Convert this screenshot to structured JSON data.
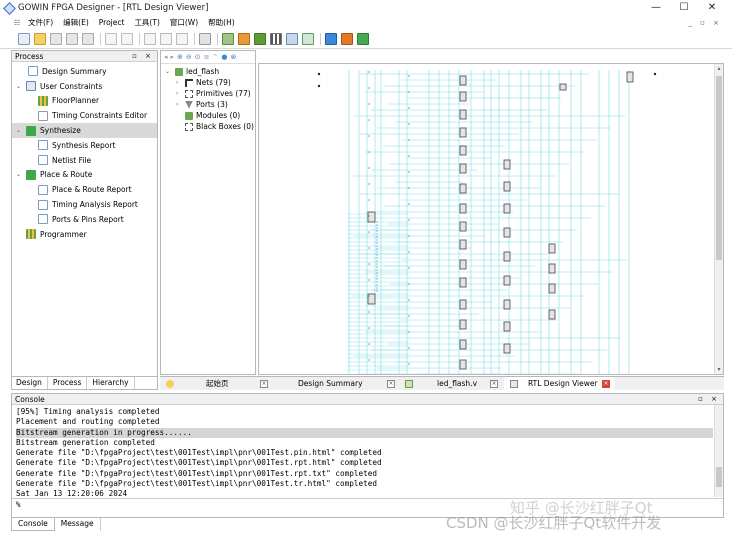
{
  "window": {
    "title": "GOWIN FPGA Designer - [RTL Design Viewer]",
    "controls": [
      "—",
      "☐",
      "✕"
    ]
  },
  "menubar": {
    "items": [
      "文件(F)",
      "编辑(E)",
      "Project",
      "工具(T)",
      "窗口(W)",
      "帮助(H)"
    ],
    "mdi_controls": "_ ▫ ×"
  },
  "process_panel": {
    "title": "Process",
    "controls": "▫ ×",
    "items": [
      {
        "label": "Design Summary",
        "level": 1,
        "icon": "document-icon"
      },
      {
        "label": "User Constraints",
        "level": 0,
        "expanded": true,
        "icon": "constraints-icon"
      },
      {
        "label": "FloorPlanner",
        "level": 1,
        "icon": "floorplanner-icon"
      },
      {
        "label": "Timing Constraints Editor",
        "level": 1,
        "icon": "clock-icon"
      },
      {
        "label": "Synthesize",
        "level": 0,
        "expanded": true,
        "icon": "check-icon",
        "selected": true
      },
      {
        "label": "Synthesis Report",
        "level": 1,
        "icon": "document-icon"
      },
      {
        "label": "Netlist File",
        "level": 1,
        "icon": "document-icon"
      },
      {
        "label": "Place & Route",
        "level": 0,
        "expanded": true,
        "icon": "check-icon"
      },
      {
        "label": "Place & Route Report",
        "level": 1,
        "icon": "document-icon"
      },
      {
        "label": "Timing Analysis Report",
        "level": 1,
        "icon": "document-icon"
      },
      {
        "label": "Ports & Pins Report",
        "level": 1,
        "icon": "document-icon"
      },
      {
        "label": "Programmer",
        "level": 0,
        "icon": "programmer-icon"
      }
    ]
  },
  "panel_tabs": [
    "Design",
    "Process",
    "Hierarchy"
  ],
  "hierarchy": {
    "root": "led_flash",
    "children": [
      {
        "label": "Nets (79)",
        "icon": "net-icon"
      },
      {
        "label": "Primitives (77)",
        "icon": "primitive-icon"
      },
      {
        "label": "Ports (3)",
        "icon": "port-icon"
      },
      {
        "label": "Modules (0)",
        "icon": "module-icon"
      },
      {
        "label": "Black Boxes (0)",
        "icon": "blackbox-icon"
      }
    ]
  },
  "doc_tabs": [
    {
      "label": "起始页",
      "icon": "bulb-icon"
    },
    {
      "label": "Design Summary",
      "icon": ""
    },
    {
      "label": "led_flash.v",
      "icon": "file-icon"
    },
    {
      "label": "RTL Design Viewer",
      "icon": "rtl-icon",
      "active": true
    }
  ],
  "console": {
    "title": "Console",
    "controls": "▫ ×",
    "lines": [
      "[95%] Timing analysis completed",
      "Placement and routing completed",
      "Bitstream generation in progress......",
      "Bitstream generation completed",
      "Generate file \"D:\\fpgaProject\\test\\001Test\\impl\\pnr\\001Test.pin.html\" completed",
      "Generate file \"D:\\fpgaProject\\test\\001Test\\impl\\pnr\\001Test.rpt.html\" completed",
      "Generate file \"D:\\fpgaProject\\test\\001Test\\impl\\pnr\\001Test.rpt.txt\" completed",
      "Generate file \"D:\\fpgaProject\\test\\001Test\\impl\\pnr\\001Test.tr.html\" completed",
      "Sat Jan 13 12:20:06 2024"
    ],
    "highlight_index": 2,
    "input_value": "%"
  },
  "console_tabs": [
    "Console",
    "Message"
  ],
  "watermark": {
    "line1": "知乎 @长沙红胖子Qt",
    "line2": "CSDN @长沙红胖子Qt软件开发"
  },
  "colors": {
    "wire": "#7fdde8",
    "selected_bg": "#d9d9d9",
    "check": "#3ca94a",
    "close_active": "#d9433a"
  }
}
